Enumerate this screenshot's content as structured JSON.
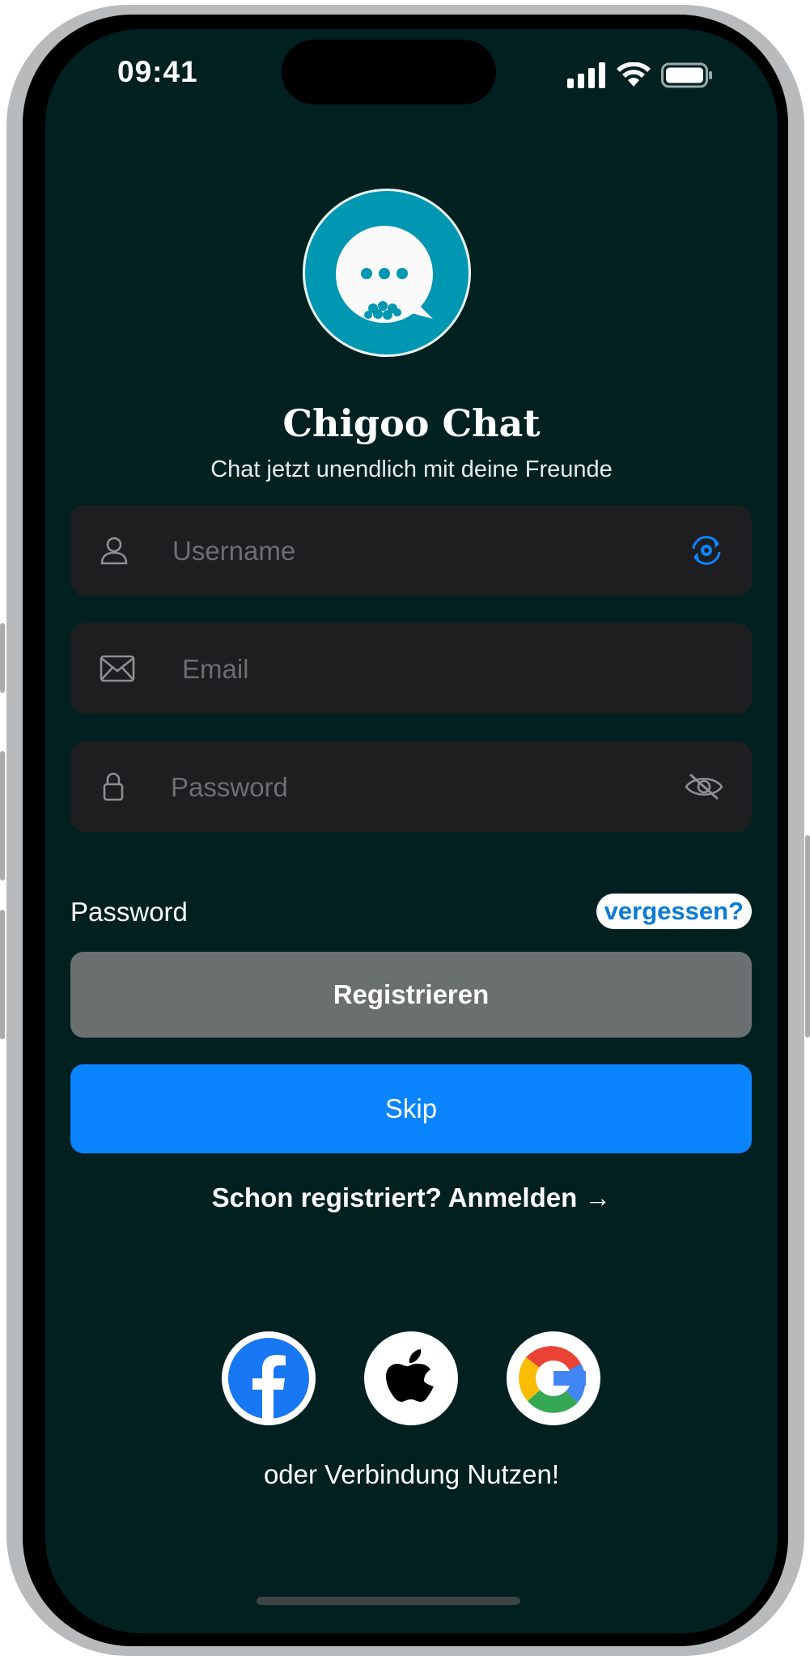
{
  "status_bar": {
    "time": "09:41"
  },
  "app": {
    "title": "Chigoo Chat",
    "subtitle": "Chat jetzt unendlich mit deine Freunde"
  },
  "form": {
    "username_placeholder": "Username",
    "email_placeholder": "Email",
    "password_placeholder": "Password",
    "password_label": "Password",
    "forgot_label": "vergessen?"
  },
  "buttons": {
    "register": "Registrieren",
    "skip": "Skip",
    "signin": "Schon registriert? Anmelden →"
  },
  "social": {
    "caption": "oder Verbindung Nutzen!",
    "providers": [
      "facebook",
      "apple",
      "google"
    ]
  },
  "colors": {
    "background": "#012120",
    "field": "#1e1e20",
    "accent_blue": "#0a84ff",
    "logo": "#0097b2",
    "register_button": "#6a6f6f"
  },
  "icons": [
    "user-icon",
    "sync-gear-icon",
    "mail-icon",
    "lock-icon",
    "eye-slash-icon",
    "chat-bubble-icon",
    "facebook-icon",
    "apple-icon",
    "google-icon",
    "signal-icon",
    "wifi-icon",
    "battery-icon"
  ]
}
